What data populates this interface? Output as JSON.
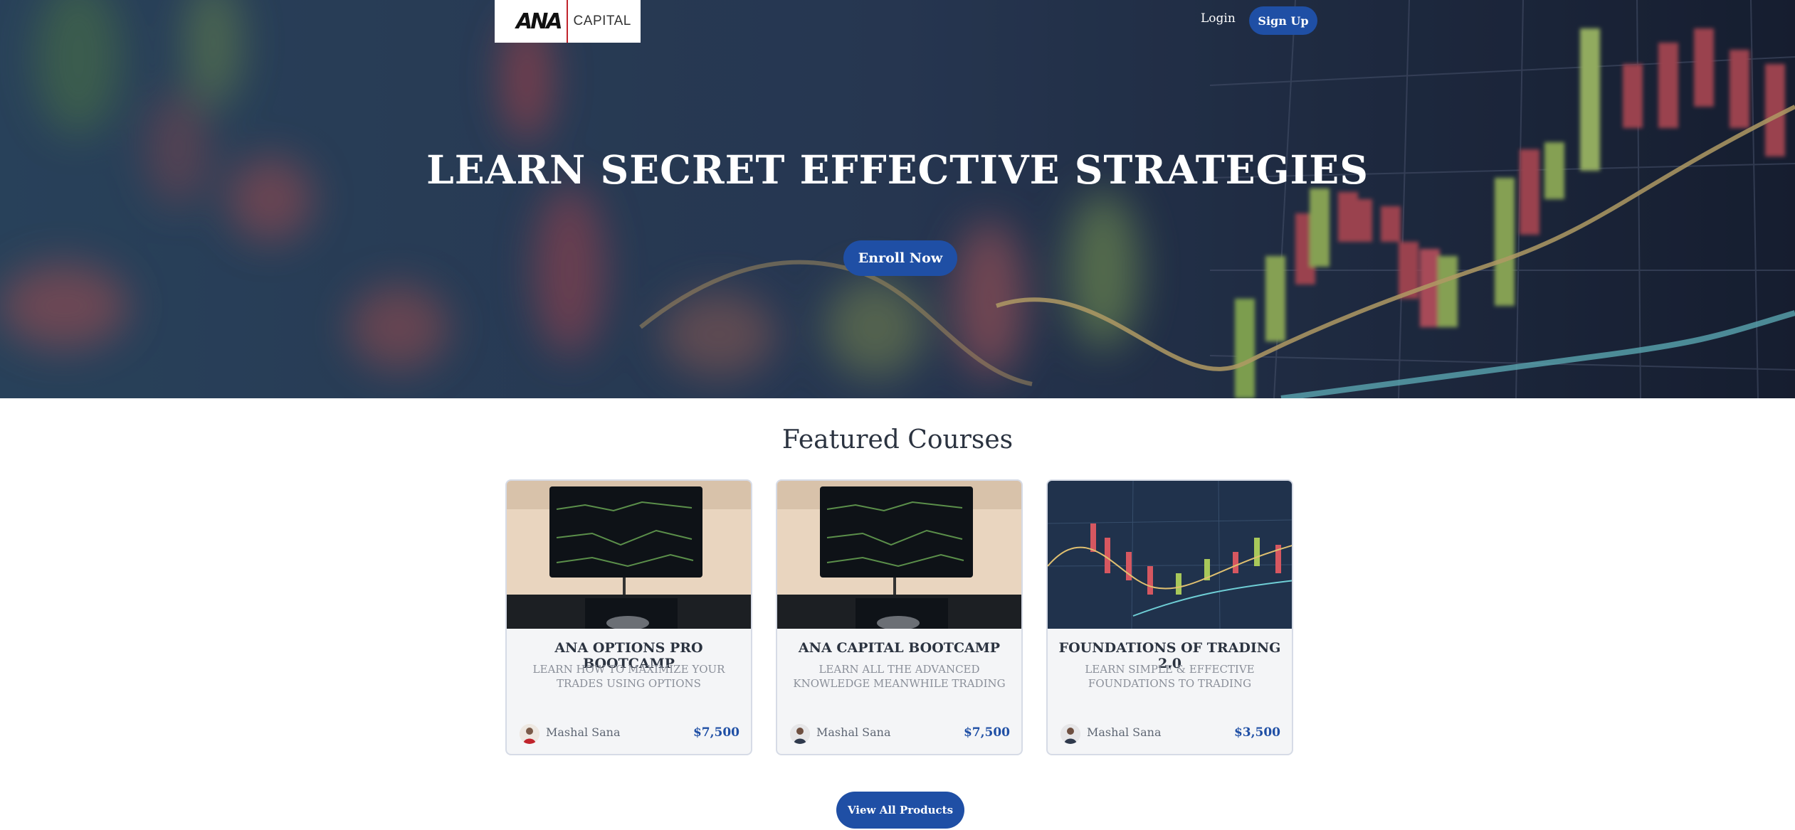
{
  "header": {
    "logo_mark": "ANA",
    "logo_text": "CAPITAL",
    "login_label": "Login",
    "signup_label": "Sign Up"
  },
  "hero": {
    "title": "LEARN SECRET EFFECTIVE STRATEGIES",
    "cta_label": "Enroll Now"
  },
  "featured": {
    "title": "Featured Courses",
    "courses": [
      {
        "title": "ANA OPTIONS PRO BOOTCAMP",
        "description": "LEARN HOW TO MAXIMIZE YOUR TRADES USING OPTIONS",
        "author": "Mashal Sana",
        "price": "$7,500"
      },
      {
        "title": "ANA CAPITAL BOOTCAMP",
        "description": "LEARN ALL THE ADVANCED KNOWLEDGE MEANWHILE TRADING ALONGSIDE…",
        "author": "Mashal Sana",
        "price": "$7,500"
      },
      {
        "title": "FOUNDATIONS OF TRADING 2.0",
        "description": "LEARN SIMPLE & EFFECTIVE FOUNDATIONS TO TRADING",
        "author": "Mashal Sana",
        "price": "$3,500"
      }
    ],
    "view_all_label": "View All Products"
  },
  "colors": {
    "accent": "#1f4fa5",
    "hero_bg": "#22324a",
    "text": "#2b3340",
    "muted": "#8a8f99"
  }
}
